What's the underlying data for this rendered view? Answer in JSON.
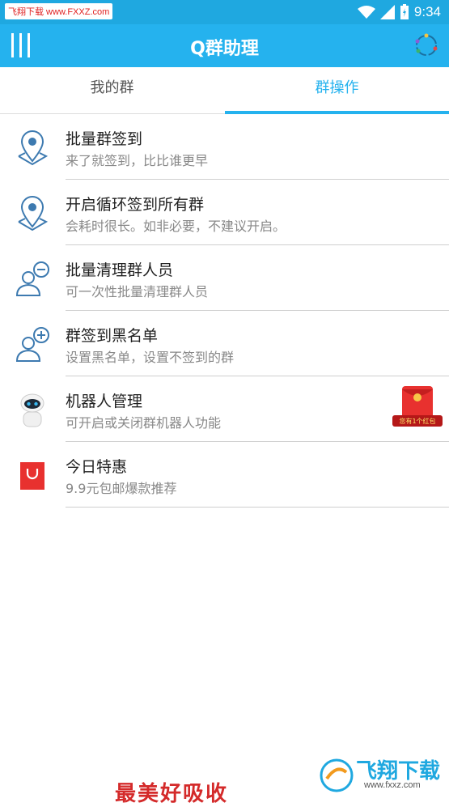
{
  "status_bar": {
    "watermark": "飞翔下载 www.FXXZ.com",
    "time": "9:34"
  },
  "app_bar": {
    "title": "Q群助理"
  },
  "tabs": [
    {
      "label": "我的群"
    },
    {
      "label": "群操作"
    }
  ],
  "items": [
    {
      "title": "批量群签到",
      "subtitle": "来了就签到，比比谁更早",
      "icon": "location-pin-icon"
    },
    {
      "title": "开启循环签到所有群",
      "subtitle": "会耗时很长。如非必要，不建议开启。",
      "icon": "location-pin-icon"
    },
    {
      "title": "批量清理群人员",
      "subtitle": "可一次性批量清理群人员",
      "icon": "user-remove-icon"
    },
    {
      "title": "群签到黑名单",
      "subtitle": "设置黑名单，设置不签到的群",
      "icon": "user-add-icon"
    },
    {
      "title": "机器人管理",
      "subtitle": "可开启或关闭群机器人功能",
      "icon": "robot-icon",
      "badge": "您有1个红包"
    },
    {
      "title": "今日特惠",
      "subtitle": "9.9元包邮爆款推荐",
      "icon": "shopping-bag-icon"
    }
  ],
  "ad": {
    "text": "最美好吸收",
    "logo_name": "飞翔下载",
    "logo_url": "www.fxxz.com"
  },
  "colors": {
    "primary": "#25b2ee",
    "icon": "#3d7ab0"
  }
}
